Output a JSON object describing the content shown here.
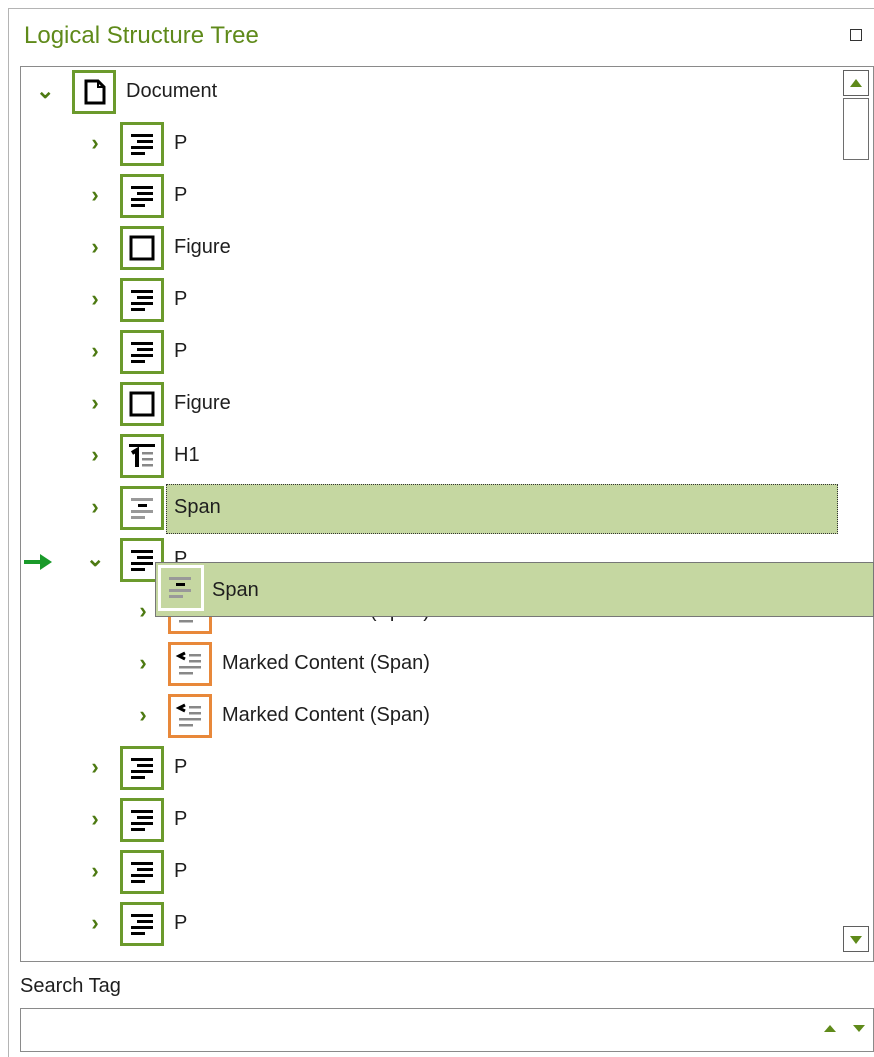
{
  "panel": {
    "title": "Logical Structure Tree"
  },
  "tree": {
    "root": {
      "label": "Document",
      "icon": "document-icon"
    },
    "items": [
      {
        "label": "P",
        "icon": "paragraph-icon"
      },
      {
        "label": "P",
        "icon": "paragraph-icon"
      },
      {
        "label": "Figure",
        "icon": "figure-icon"
      },
      {
        "label": "P",
        "icon": "paragraph-icon"
      },
      {
        "label": "P",
        "icon": "paragraph-icon"
      },
      {
        "label": "Figure",
        "icon": "figure-icon"
      },
      {
        "label": "H1",
        "icon": "heading-icon"
      },
      {
        "label": "Span",
        "icon": "span-icon"
      },
      {
        "label": "P",
        "icon": "paragraph-icon"
      },
      {
        "label": "Marked Content (Span)",
        "icon": "marked-content-icon"
      },
      {
        "label": "Marked Content (Span)",
        "icon": "marked-content-icon"
      },
      {
        "label": "Marked Content (Span)",
        "icon": "marked-content-icon"
      },
      {
        "label": "P",
        "icon": "paragraph-icon"
      },
      {
        "label": "P",
        "icon": "paragraph-icon"
      },
      {
        "label": "P",
        "icon": "paragraph-icon"
      },
      {
        "label": "P",
        "icon": "paragraph-icon"
      }
    ],
    "drag_ghost": {
      "label": "Span",
      "icon": "span-icon"
    }
  },
  "search": {
    "label": "Search Tag",
    "value": ""
  },
  "colors": {
    "accent": "#5f8a1a",
    "selection": "#c5d7a1",
    "tag_border": "#6b9a2c",
    "content_border": "#e8883a"
  }
}
